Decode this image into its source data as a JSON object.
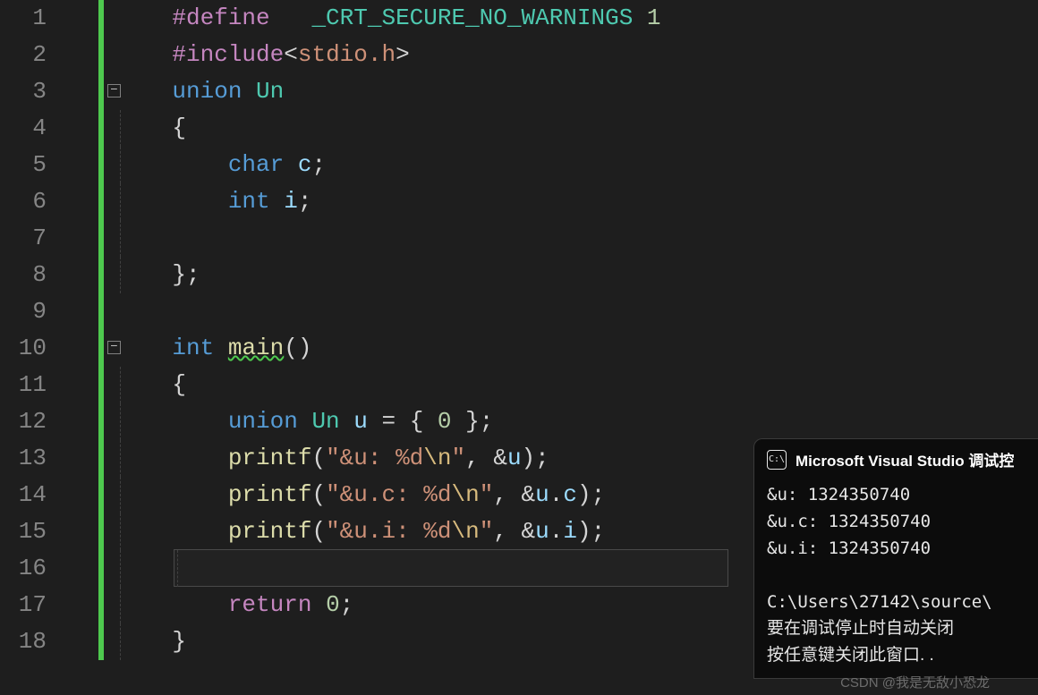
{
  "gutter": {
    "lines": [
      "1",
      "2",
      "3",
      "4",
      "5",
      "6",
      "7",
      "8",
      "9",
      "10",
      "11",
      "12",
      "13",
      "14",
      "15",
      "16",
      "17",
      "18"
    ]
  },
  "code": {
    "l1": {
      "pp": "#define",
      "sp": "   ",
      "macro": "_CRT_SECURE_NO_WARNINGS",
      "num": "1"
    },
    "l2": {
      "pp": "#include",
      "open": "<",
      "hdr": "stdio.h",
      "close": ">"
    },
    "l3": {
      "kw": "union",
      "name": "Un"
    },
    "l4": {
      "brace": "{"
    },
    "l5": {
      "type": "char",
      "var": "c",
      "semi": ";"
    },
    "l6": {
      "type": "int",
      "var": "i",
      "semi": ";"
    },
    "l8": {
      "brace": "};"
    },
    "l10": {
      "type": "int",
      "fn": "main",
      "paren": "()"
    },
    "l11": {
      "brace": "{"
    },
    "l12": {
      "kw": "union",
      "ty": "Un",
      "var": "u",
      "eq": " = ",
      "bo": "{ ",
      "zero": "0",
      "bc": " };"
    },
    "l13": {
      "fn": "printf",
      "po": "(",
      "str1": "\"&u: %d",
      "esc": "\\n",
      "str2": "\"",
      "comma": ", ",
      "amp": "&",
      "var": "u",
      "pc": ");"
    },
    "l14": {
      "fn": "printf",
      "po": "(",
      "str1": "\"&u.c: %d",
      "esc": "\\n",
      "str2": "\"",
      "comma": ", ",
      "amp": "&",
      "var": "u",
      "dot": ".",
      "mem": "c",
      "pc": ");"
    },
    "l15": {
      "fn": "printf",
      "po": "(",
      "str1": "\"&u.i: %d",
      "esc": "\\n",
      "str2": "\"",
      "comma": ", ",
      "amp": "&",
      "var": "u",
      "dot": ".",
      "mem": "i",
      "pc": ");"
    },
    "l17": {
      "ret": "return",
      "zero": "0",
      "semi": ";"
    },
    "l18": {
      "brace": "}"
    }
  },
  "fold": {
    "minus": "−"
  },
  "console": {
    "title": "Microsoft Visual Studio 调试控",
    "icon_glyph": "C:\\",
    "out1": "&u:  1324350740",
    "out2": "&u.c:  1324350740",
    "out3": "&u.i:  1324350740",
    "path": "C:\\Users\\27142\\source\\",
    "cjk1": "要在调试停止时自动关闭",
    "cjk2": "按任意键关闭此窗口. ."
  },
  "watermark": "CSDN @我是无敌小恐龙"
}
